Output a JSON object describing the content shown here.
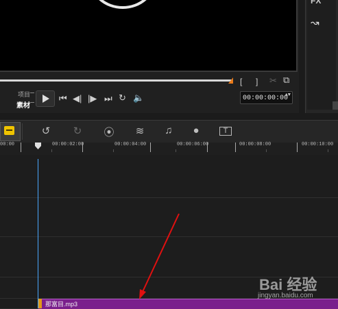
{
  "player": {
    "mode_project": "项目",
    "mode_clip": "素材",
    "timecode": "00:00:00:00",
    "timecode_spin": "▲▼",
    "icons": [
      "play-icon",
      "to-start-icon",
      "prev-frame-icon",
      "next-frame-icon",
      "to-end-icon",
      "repeat-icon",
      "volume-icon"
    ],
    "mark_in": "[",
    "mark_out": "]"
  },
  "right_panel": {
    "fx_label": "FX"
  },
  "toolbar": {
    "icons": [
      "storyboard-icon",
      "undo-icon",
      "redo-icon",
      "record-capture-icon",
      "sound-mixer-icon",
      "auto-music-icon",
      "motion-track-icon",
      "title-icon"
    ]
  },
  "ruler": {
    "labels": [
      "00:00",
      "00:00:02:00",
      "00:00:04:00",
      "00:00:06:00",
      "00:00:08:00",
      "00:00:10:00"
    ]
  },
  "clip": {
    "name": "那富目.mp3"
  },
  "watermark": {
    "logo": "Bai 经验",
    "url": "jingyan.baidu.com"
  },
  "colors": {
    "clip": "#7a1f8c",
    "playhead": "#4aa8ff",
    "scrub_end": "#e87a1a",
    "storyboard_accent": "#f0c400"
  }
}
